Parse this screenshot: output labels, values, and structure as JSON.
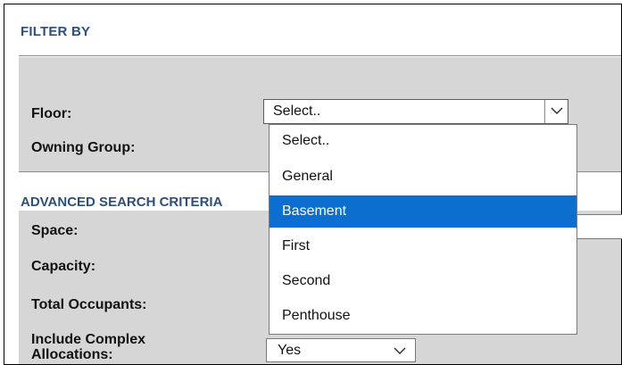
{
  "filter": {
    "title": "FILTER BY",
    "floor_label": "Floor:",
    "owning_group_label": "Owning Group:",
    "floor_select": {
      "value": "Select..",
      "options": [
        "Select..",
        "General",
        "Basement",
        "First",
        "Second",
        "Penthouse"
      ],
      "highlighted": "Basement"
    }
  },
  "advanced": {
    "title": "ADVANCED SEARCH CRITERIA",
    "space_label": "Space:",
    "capacity_label": "Capacity:",
    "total_occupants_label": "Total Occupants:",
    "complex_allocations_label": "Include Complex Allocations:",
    "complex_allocations_value": "Yes"
  },
  "icons": {
    "floor_select": "chevron-down-icon",
    "complex_select": "chevron-down-icon"
  },
  "colors": {
    "header_text": "#2d4f7c",
    "panel_bg": "#d6d6d6",
    "highlight": "#0c6fd0"
  }
}
